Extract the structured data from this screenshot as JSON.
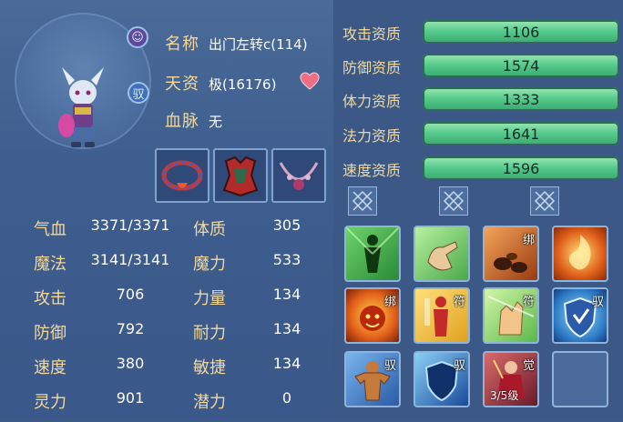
{
  "pet": {
    "name_label": "名称",
    "name_value": "出门左转c(114)",
    "talent_label": "天资",
    "talent_value": "极(16176)",
    "bloodline_label": "血脉",
    "bloodline_value": "无",
    "badge_top": "☺",
    "badge_mid": "驭"
  },
  "stats": [
    {
      "label": "气血",
      "value": "3371/3371",
      "label2": "体质",
      "value2": "305"
    },
    {
      "label": "魔法",
      "value": "3141/3141",
      "label2": "魔力",
      "value2": "533"
    },
    {
      "label": "攻击",
      "value": "706",
      "label2": "力量",
      "value2": "134"
    },
    {
      "label": "防御",
      "value": "792",
      "label2": "耐力",
      "value2": "134"
    },
    {
      "label": "速度",
      "value": "380",
      "label2": "敏捷",
      "value2": "134"
    },
    {
      "label": "灵力",
      "value": "901",
      "label2": "潜力",
      "value2": "0"
    }
  ],
  "aptitudes": [
    {
      "label": "攻击资质",
      "value": "1106"
    },
    {
      "label": "防御资质",
      "value": "1574"
    },
    {
      "label": "体力资质",
      "value": "1333"
    },
    {
      "label": "法力资质",
      "value": "1641"
    },
    {
      "label": "速度资质",
      "value": "1596"
    }
  ],
  "equipment": [
    "necklace-red-icon",
    "armor-red-icon",
    "necklace-pink-icon"
  ],
  "skills": [
    {
      "icon": "green-figure-icon",
      "tag": "",
      "level": ""
    },
    {
      "icon": "green-hand-icon",
      "tag": "",
      "level": ""
    },
    {
      "icon": "rock-bind-icon",
      "tag": "绑",
      "level": ""
    },
    {
      "icon": "fire-swirl-icon",
      "tag": "",
      "level": ""
    },
    {
      "icon": "fire-demon-icon",
      "tag": "绑",
      "level": ""
    },
    {
      "icon": "red-figure-talisman-icon",
      "tag": "符",
      "level": ""
    },
    {
      "icon": "palm-talisman-icon",
      "tag": "符",
      "level": ""
    },
    {
      "icon": "shield-blue-icon",
      "tag": "驭",
      "level": ""
    },
    {
      "icon": "muscle-man-icon",
      "tag": "驭",
      "level": ""
    },
    {
      "icon": "shield-dark-icon",
      "tag": "驭",
      "level": ""
    },
    {
      "icon": "red-warrior-icon",
      "tag": "觉",
      "level": "3/5级"
    },
    {
      "icon": "empty",
      "tag": "",
      "level": ""
    }
  ],
  "colors": {
    "label_gold": "#f3d89a",
    "bar_green": "#53c98a",
    "panel_blue": "#3b5887"
  }
}
